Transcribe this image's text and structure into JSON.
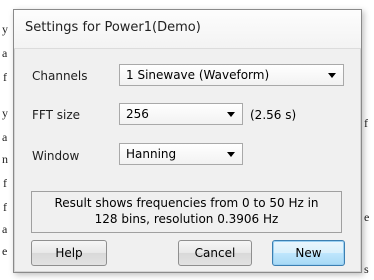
{
  "background": {
    "fragments": [
      "y",
      "a",
      "f",
      "y",
      "a",
      "n",
      "f",
      "f",
      "a",
      "e",
      "f",
      "e",
      "s"
    ]
  },
  "dialog": {
    "title": "Settings for Power1(Demo)",
    "channels": {
      "label": "Channels",
      "value": "1 Sinewave (Waveform)"
    },
    "fft_size": {
      "label": "FFT size",
      "value": "256",
      "duration": "(2.56 s)"
    },
    "window": {
      "label": "Window",
      "value": "Hanning"
    },
    "info": {
      "line1": "Result shows frequencies from 0 to 50 Hz in",
      "line2": "128 bins, resolution 0.3906 Hz"
    },
    "buttons": {
      "help": "Help",
      "cancel": "Cancel",
      "new": "New"
    }
  },
  "colors": {
    "dialog_bg": "#f0f0f0",
    "default_button_border": "#3c7fb1"
  }
}
